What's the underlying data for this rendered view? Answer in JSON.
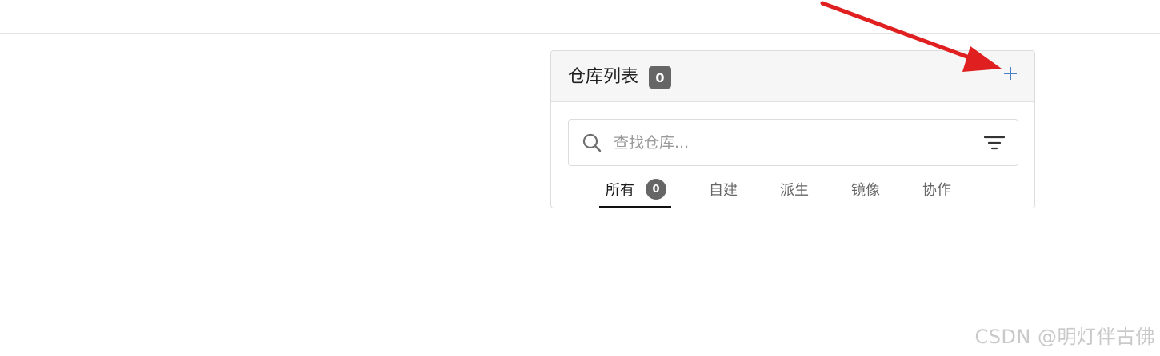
{
  "panel": {
    "title": "仓库列表",
    "count": "0",
    "add_icon": "plus-icon"
  },
  "search": {
    "placeholder": "查找仓库...",
    "value": "",
    "search_icon": "search-icon",
    "filter_icon": "filter-icon"
  },
  "tabs": [
    {
      "label": "所有",
      "badge": "0",
      "active": true
    },
    {
      "label": "自建"
    },
    {
      "label": "派生"
    },
    {
      "label": "镜像"
    },
    {
      "label": "协作"
    }
  ],
  "colors": {
    "accent": "#4a7fc1",
    "badge_bg": "#666666",
    "arrow": "#e02020"
  },
  "watermark": "CSDN @明灯伴古佛"
}
